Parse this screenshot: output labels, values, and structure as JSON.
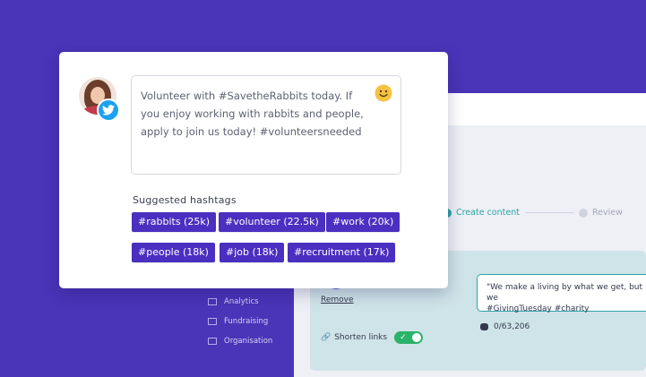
{
  "composer": {
    "text": "Volunteer with #SavetheRabbits today. If you enjoy working with rabbits and people, apply to join us today! #volunteersneeded",
    "suggested_label": "Suggested hashtags",
    "hashtags": [
      "#rabbits (25k)",
      "#volunteer (22.5k)",
      "#work (20k)",
      "#people (18k)",
      "#job (18k)",
      "#recruitment (17k)"
    ],
    "network_icon": "twitter-icon",
    "emoji_icon": "smiley-icon"
  },
  "background_app": {
    "steps": [
      "Create content",
      "Review"
    ],
    "sidebar_items": [
      "Analytics",
      "Fundraising",
      "Organisation"
    ],
    "remove_label": "Remove",
    "shorten_links_label": "Shorten links",
    "quote_line1": "\"We make a living by what we get, but we",
    "quote_line2": "#GivingTuesday #charity",
    "char_count": "0/63,206",
    "accent": "#2aa3a6",
    "toggle_color": "#2ab36a"
  },
  "colors": {
    "page_bg": "#4a34b8",
    "hashtag_bg": "#4a2fc0",
    "twitter": "#1da1f2"
  }
}
